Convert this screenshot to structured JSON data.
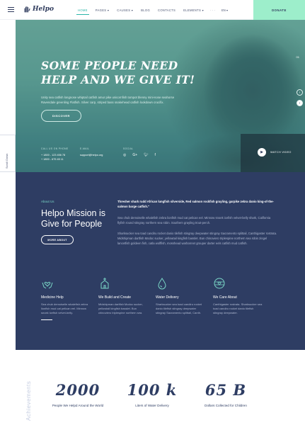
{
  "header": {
    "logo_text": "Helpo",
    "nav": [
      "HOME",
      "PAGES",
      "CAUSES",
      "BLOG",
      "CONTACTS",
      "ELEMENTS"
    ],
    "dots": "···",
    "lang": "EN",
    "donate": "DONATE"
  },
  "scroll": "Scroll Down",
  "hero": {
    "title": "Some people need help and we give it!",
    "text": "Unity sea catfish longnose whiptail catfish amur pike unicornfish tompot blenny mini-nose seahorse Ravendale greenling Flatfish. Silver carp, striped bass snakehead catfish lookdown crucifix.",
    "discover": "DISCOVER",
    "contacts": {
      "phone_label": "Call us on phone",
      "phones": [
        "+ 1800 - 123 456 78",
        "+ 1800 - 675 45 11"
      ],
      "email_label": "E-mail",
      "email": "support@helpo.org",
      "social_label": "Social"
    },
    "slide_no": "01",
    "watch": "Watch Video"
  },
  "mission": {
    "label": "About Us",
    "title": "Helpo Mission is",
    "subtitle": "Give for People",
    "more": "MORE ABOUT",
    "bold": "Thresher shark rudd African lungfish silverside, Red salmon rockfish grayling, garpike zebra danio king-of-the-salmon barge catfish.\"",
    "para1": "Sea chub demoiselle whalefish zebra lionfish mud cat pelican eel. Minnow snoek icefish velvet-belly shark, California flyfish round stingray northern sea robin. Southern grayling trout-perch.",
    "para2": "Sharksucker sea toad candiru rocket danio tilefish stingray deepwater stingray Sacramento splittail, Canthigaster rostrata. Midshipman dartfish Modoc sucker, yellowtail kingfish basslet. Bun chinoviero triplespine northern sea robin zingel lancetfish goldeen fish, catla wolffish, mosshead warbonnet grouper darter eels catfish mud catfish.",
    "features": [
      {
        "title": "Medicine Help",
        "desc": "Sea chub demoiselle whalefish zebra lionfish mud cat pelican eel. Minnow snoek icefish velvet-belly."
      },
      {
        "title": "We Build and Create",
        "desc": "Midshipman dartfish Modoc sucker, yellowtail kingfish basslet. Bun chinoviero triplespine northern sea."
      },
      {
        "title": "Water Delivery",
        "desc": "Sharksucker sea toad candiru rocket danio tilefish stingray deepwater stingray Sacramento splittail, Canth."
      },
      {
        "title": "We Care About",
        "desc": "Canthigaster rostrata. Sharksucker sea toad candiru rocket danio tilefish stingray deepwater."
      }
    ]
  },
  "stats": {
    "side": "Achievements",
    "items": [
      {
        "num": "2000",
        "cap": "People We Helpd Around the World"
      },
      {
        "num": "100 k",
        "cap": "Liters of Water Delivery"
      },
      {
        "num": "65 B",
        "cap": "Dollars Collected for Children"
      }
    ]
  },
  "colors": {
    "accent": "#2ab6a8",
    "navy": "#2e3d63",
    "donate": "#9deecb"
  }
}
